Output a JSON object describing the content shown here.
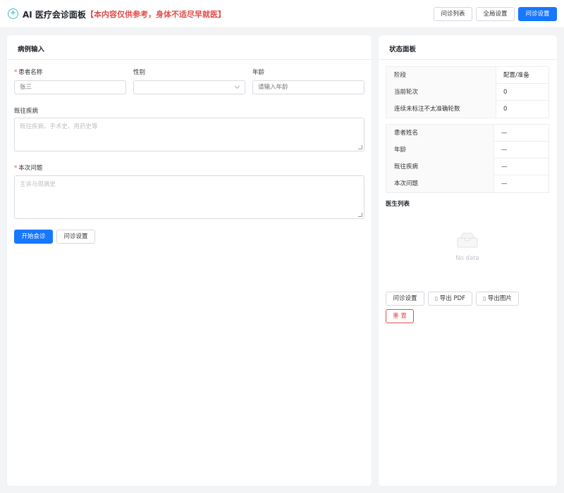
{
  "header": {
    "app_title": "AI 医疗会诊面板",
    "disclaimer": "【本内容仅供参考，身体不适尽早就医】",
    "buttons": {
      "consult_list": "问诊列表",
      "global_settings": "全局设置",
      "consult_settings": "问诊设置"
    }
  },
  "case_input": {
    "title": "病例输入",
    "patient_name": {
      "label": "患者名称",
      "placeholder": "张三"
    },
    "gender": {
      "label": "性别",
      "value": ""
    },
    "age": {
      "label": "年龄",
      "placeholder": "请输入年龄"
    },
    "history": {
      "label": "既往疾病",
      "placeholder": "既往疾病、手术史、用药史等"
    },
    "problem": {
      "label": "本次问题",
      "placeholder": "主诉与现病史"
    },
    "buttons": {
      "start": "开始会诊",
      "settings": "问诊设置"
    }
  },
  "status_panel": {
    "title": "状态面板",
    "status_rows": [
      {
        "key": "阶段",
        "value": "配置/准备"
      },
      {
        "key": "当前轮次",
        "value": "0"
      },
      {
        "key": "连续未标注不太准确轮数",
        "value": "0"
      }
    ],
    "patient_rows": [
      {
        "key": "患者姓名",
        "value": "—"
      },
      {
        "key": "年龄",
        "value": "—"
      },
      {
        "key": "既往疾病",
        "value": "—"
      },
      {
        "key": "本次问题",
        "value": "—"
      }
    ],
    "doctor_list_title": "医生列表",
    "empty_text": "No data",
    "buttons": {
      "consult_settings": "问诊设置",
      "export_pdf": "导出 PDF",
      "export_image": "导出图片",
      "reset": "重 置"
    }
  },
  "colors": {
    "primary": "#1677ff",
    "danger": "#e24b4b",
    "logo": "#3fb8c7"
  }
}
